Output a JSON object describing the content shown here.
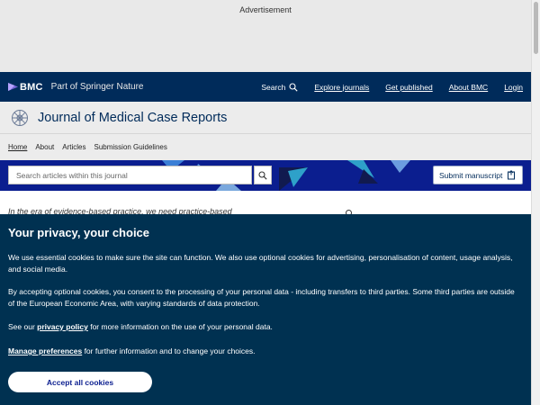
{
  "ad": {
    "label": "Advertisement"
  },
  "topnav": {
    "logo_text": "BMC",
    "brand_sub": "Part of Springer Nature",
    "search_label": "Search",
    "explore_label": "Explore journals",
    "get_published_label": "Get published",
    "about_label": "About BMC",
    "login_label": "Login"
  },
  "journal": {
    "title": "Journal of Medical Case Reports"
  },
  "subnav": {
    "items": [
      "Home",
      "About",
      "Articles",
      "Submission Guidelines"
    ]
  },
  "hero": {
    "search_placeholder": "Search articles within this journal",
    "submit_label": "Submit manuscript"
  },
  "body_peek": {
    "text": "In the era of evidence-based practice, we need practice-based"
  },
  "cookie": {
    "title": "Your privacy, your choice",
    "p1": "We use essential cookies to make sure the site can function. We also use optional cookies for advertising, personalisation of content, usage analysis, and social media.",
    "p2": "By accepting optional cookies, you consent to the processing of your personal data - including transfers to third parties. Some third parties are outside of the European Economic Area, with varying standards of data protection.",
    "p3_prefix": "See our ",
    "privacy_link": "privacy policy",
    "p3_suffix": " for more information on the use of your personal data.",
    "manage_link": "Manage preferences",
    "p4_suffix": " for further information and to change your choices.",
    "accept_label": "Accept all cookies"
  },
  "colors": {
    "topnav_bg": "#002b5a",
    "hero_bg": "#0b1e8f",
    "cookie_bg": "#003151",
    "accent": "#b5a2ff"
  }
}
